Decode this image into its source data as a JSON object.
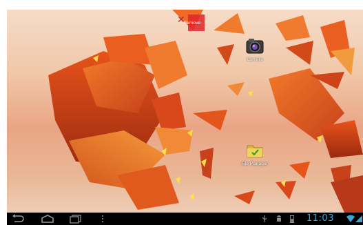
{
  "remove_target": {
    "label": "Remove"
  },
  "desktop": {
    "icons": [
      {
        "id": "camera",
        "label": "Camera",
        "icon": "camera-icon"
      },
      {
        "id": "file-manager",
        "label": "File Manager",
        "icon": "folder-icon"
      }
    ]
  },
  "system_bar": {
    "buttons": [
      "back-icon",
      "home-icon",
      "recent-apps-icon",
      "menu-icon"
    ],
    "status_icons": [
      "usb-icon",
      "android-debug-icon",
      "battery-icon",
      "wifi-icon",
      "signal-icon"
    ],
    "time": "11:03"
  },
  "colors": {
    "clock": "#3aa6d9",
    "remove_target": "#e2232a",
    "shard_primary": "#e8531a",
    "wallpaper_sky": "#f0c7a8"
  }
}
